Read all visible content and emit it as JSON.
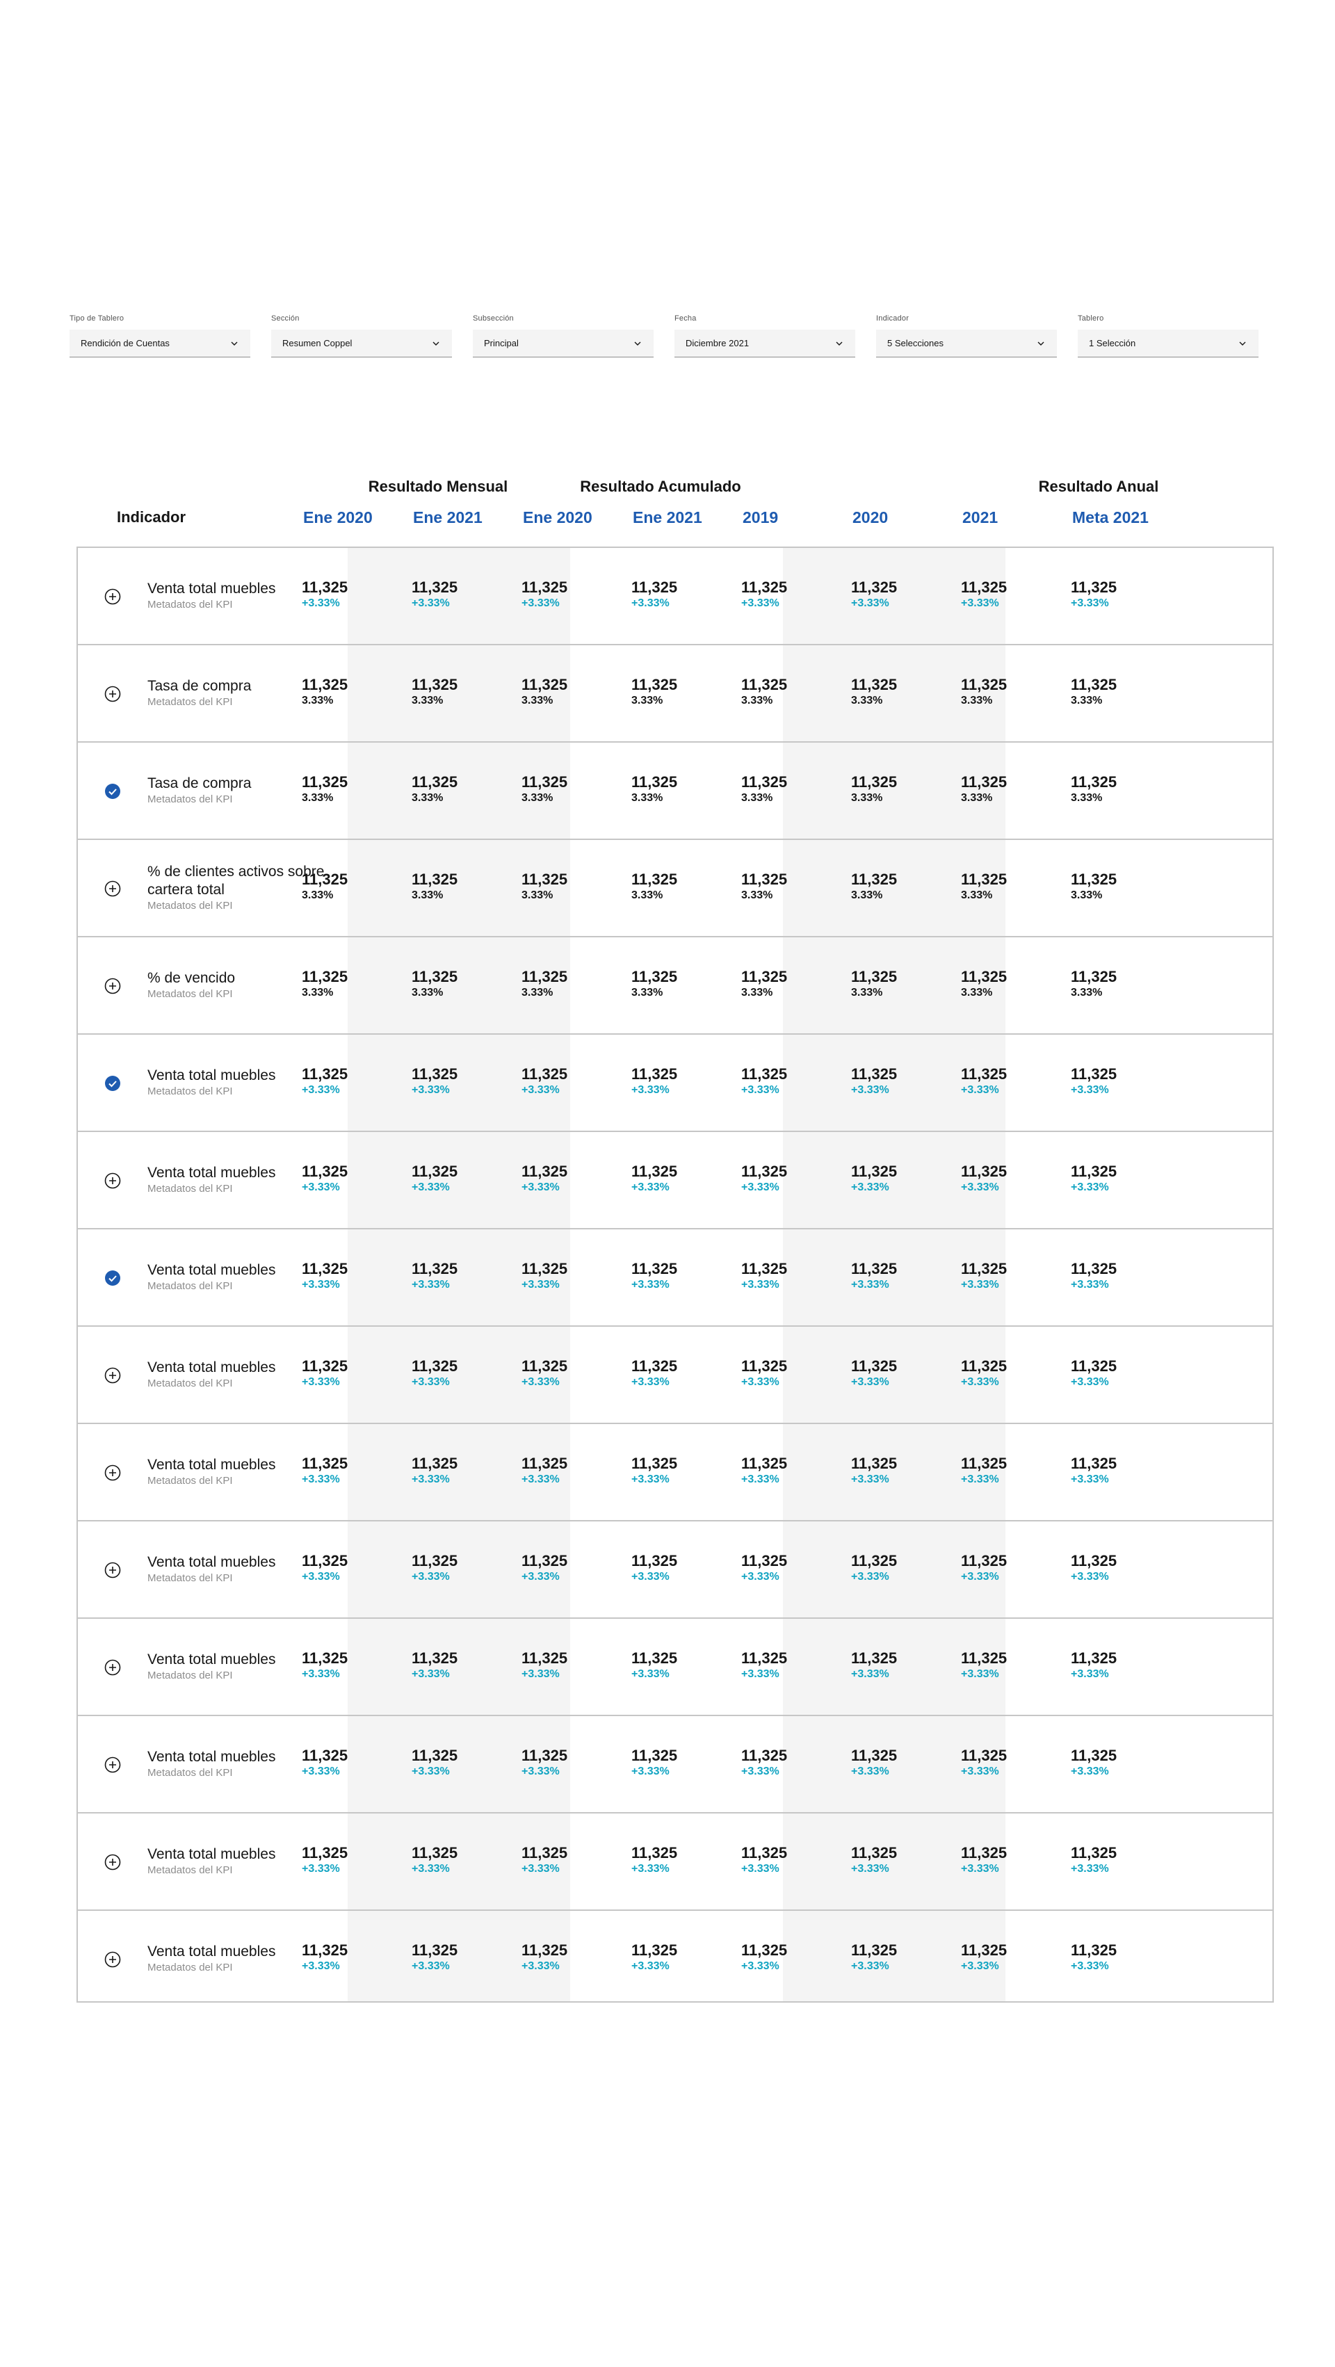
{
  "filters": [
    {
      "label": "Tipo de Tablero",
      "value": "Rendición de Cuentas"
    },
    {
      "label": "Sección",
      "value": "Resumen Coppel"
    },
    {
      "label": "Subsección",
      "value": "Principal"
    },
    {
      "label": "Fecha",
      "value": "Diciembre 2021"
    },
    {
      "label": "Indicador",
      "value": "5 Selecciones"
    },
    {
      "label": "Tablero",
      "value": "1 Selección"
    }
  ],
  "table": {
    "indicator_header": "Indicador",
    "groups": [
      {
        "title": "Resultado Mensual"
      },
      {
        "title": "Resultado Acumulado"
      },
      {
        "title": "Resultado Anual"
      }
    ],
    "columns": [
      "Ene 2020",
      "Ene 2021",
      "Ene 2020",
      "Ene 2021",
      "2019",
      "2020",
      "2021",
      "Meta 2021"
    ],
    "rows": [
      {
        "name": "Venta total muebles",
        "meta": "Metadatos del KPI",
        "state": "add",
        "value": "11,325",
        "delta": "+3.33%",
        "trend": "up"
      },
      {
        "name": "Tasa de compra",
        "meta": "Metadatos del KPI",
        "state": "add",
        "value": "11,325",
        "delta": "3.33%",
        "trend": "flat"
      },
      {
        "name": "Tasa de compra",
        "meta": "Metadatos del KPI",
        "state": "selected",
        "value": "11,325",
        "delta": "3.33%",
        "trend": "flat"
      },
      {
        "name": "% de clientes activos sobre cartera total",
        "meta": "Metadatos del KPI",
        "state": "add",
        "value": "11,325",
        "delta": "3.33%",
        "trend": "flat"
      },
      {
        "name": "% de vencido",
        "meta": "Metadatos del KPI",
        "state": "add",
        "value": "11,325",
        "delta": "3.33%",
        "trend": "flat"
      },
      {
        "name": "Venta total muebles",
        "meta": "Metadatos del KPI",
        "state": "selected",
        "value": "11,325",
        "delta": "+3.33%",
        "trend": "up"
      },
      {
        "name": "Venta total muebles",
        "meta": "Metadatos del KPI",
        "state": "add",
        "value": "11,325",
        "delta": "+3.33%",
        "trend": "up"
      },
      {
        "name": "Venta total muebles",
        "meta": "Metadatos del KPI",
        "state": "selected",
        "value": "11,325",
        "delta": "+3.33%",
        "trend": "up"
      },
      {
        "name": "Venta total muebles",
        "meta": "Metadatos del KPI",
        "state": "add",
        "value": "11,325",
        "delta": "+3.33%",
        "trend": "up"
      },
      {
        "name": "Venta total muebles",
        "meta": "Metadatos del KPI",
        "state": "add",
        "value": "11,325",
        "delta": "+3.33%",
        "trend": "up"
      },
      {
        "name": "Venta total muebles",
        "meta": "Metadatos del KPI",
        "state": "add",
        "value": "11,325",
        "delta": "+3.33%",
        "trend": "up"
      },
      {
        "name": "Venta total muebles",
        "meta": "Metadatos del KPI",
        "state": "add",
        "value": "11,325",
        "delta": "+3.33%",
        "trend": "up"
      },
      {
        "name": "Venta total muebles",
        "meta": "Metadatos del KPI",
        "state": "add",
        "value": "11,325",
        "delta": "+3.33%",
        "trend": "up"
      },
      {
        "name": "Venta total muebles",
        "meta": "Metadatos del KPI",
        "state": "add",
        "value": "11,325",
        "delta": "+3.33%",
        "trend": "up"
      },
      {
        "name": "Venta total muebles",
        "meta": "Metadatos del KPI",
        "state": "add",
        "value": "11,325",
        "delta": "+3.33%",
        "trend": "up"
      }
    ]
  },
  "colors": {
    "accent": "#1e5bb0",
    "delta_up": "#12a4c2",
    "selected_icon": "#1e5bb0",
    "shade": "#f4f4f4"
  }
}
